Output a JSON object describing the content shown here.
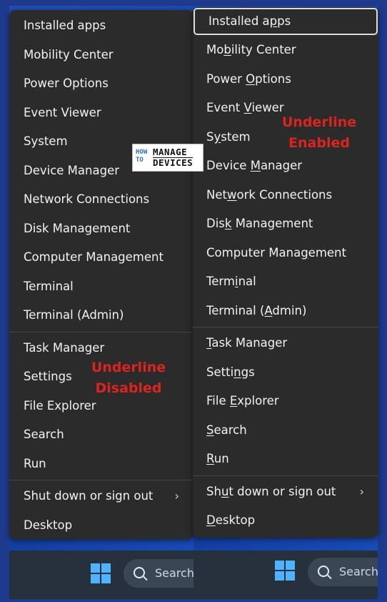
{
  "left_menu": {
    "items_group1": [
      "Installed apps",
      "Mobility Center",
      "Power Options",
      "Event Viewer",
      "System",
      "Device Manager",
      "Network Connections",
      "Disk Management",
      "Computer Management",
      "Terminal",
      "Terminal (Admin)"
    ],
    "items_group2": [
      "Task Manager",
      "Settings",
      "File Explorer",
      "Search",
      "Run"
    ],
    "shutdown": "Shut down or sign out",
    "desktop": "Desktop",
    "note_line1": "Underline",
    "note_line2": "Disabled"
  },
  "right_menu": {
    "items": [
      {
        "pre": "Installed a",
        "u": "p",
        "post": "ps"
      },
      {
        "pre": "Mo",
        "u": "b",
        "post": "ility Center"
      },
      {
        "pre": "Power ",
        "u": "O",
        "post": "ptions"
      },
      {
        "pre": "Event ",
        "u": "V",
        "post": "iewer"
      },
      {
        "pre": "S",
        "u": "y",
        "post": "stem"
      },
      {
        "pre": "Device ",
        "u": "M",
        "post": "anager"
      },
      {
        "pre": "Net",
        "u": "w",
        "post": "ork Connections"
      },
      {
        "pre": "Dis",
        "u": "k",
        "post": " Management"
      },
      {
        "pre": "Computer Mana",
        "u": "g",
        "post": "ement"
      },
      {
        "pre": "Term",
        "u": "i",
        "post": "nal"
      },
      {
        "pre": "Terminal (",
        "u": "A",
        "post": "dmin)"
      }
    ],
    "items_group2": [
      {
        "pre": "",
        "u": "T",
        "post": "ask Manager"
      },
      {
        "pre": "Setti",
        "u": "n",
        "post": "gs"
      },
      {
        "pre": "File ",
        "u": "E",
        "post": "xplorer"
      },
      {
        "pre": "",
        "u": "S",
        "post": "earch"
      },
      {
        "pre": "",
        "u": "R",
        "post": "un"
      }
    ],
    "shutdown": {
      "pre": "Sh",
      "u": "u",
      "post": "t down or sign out"
    },
    "desktop": {
      "pre": "",
      "u": "D",
      "post": "esktop"
    },
    "note_line1": "Underline",
    "note_line2": "Enabled"
  },
  "logo": {
    "how": "HOW",
    "to": "TO",
    "manage": "MANAGE",
    "devices": "DEVICES"
  },
  "taskbar": {
    "search_label": "Search"
  },
  "icons": {
    "chevron": "chevron-right-icon",
    "search": "search-icon",
    "windows": "windows-start-icon"
  },
  "colors": {
    "menu_bg": "#2b2b2b",
    "note_red": "#d9241f",
    "accent_blue": "#4fb3ff"
  }
}
